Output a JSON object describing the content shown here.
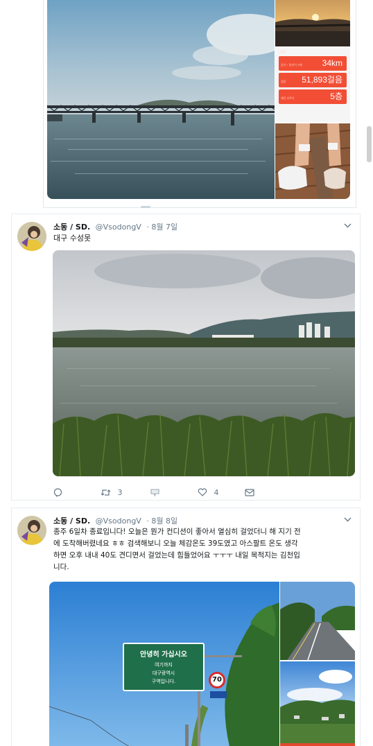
{
  "tweet1": {
    "stats": {
      "caption": "활동",
      "rows": [
        {
          "label": "걷기 + 달리기 거리",
          "value": "34km"
        },
        {
          "label": "걸음",
          "value": "51,893걸음"
        },
        {
          "label": "계단 오르기",
          "value": "5층"
        }
      ]
    }
  },
  "tweet2": {
    "name": "소동 / SD.",
    "handle": "@VsodongV",
    "date": "· 8월 7일",
    "text": "대구 수성못",
    "actions": {
      "reply": "",
      "retweet": "3",
      "message_share": "",
      "like": "4",
      "dm": ""
    }
  },
  "tweet3": {
    "name": "소동 / SD.",
    "handle": "@VsodongV",
    "date": "· 8월 8일",
    "text_lines": [
      "종주 6일차 종료입니다! 오늘은 뭔가 컨디션이 좋아서 열심히 걸었더니 해 지기 전",
      "에 도착해버렸네요 ㅎㅎ 검색해보니 오늘 체감온도 39도였고 아스팔트 온도 생각",
      "하면 오후 내내 40도 견디면서 걸었는데 힘들었어요 ㅜㅜㅜ 내일 목적지는 김천입",
      "니다."
    ],
    "sign": {
      "line1": "안녕히 가십시오",
      "line2": "여기까지",
      "line3": "대구광역시",
      "line4": "구역입니다.",
      "speed_limit": "70"
    }
  },
  "colors": {
    "stat_red": "#f24e35",
    "sign_green": "#1f6f4a",
    "link_gray": "#657786"
  }
}
